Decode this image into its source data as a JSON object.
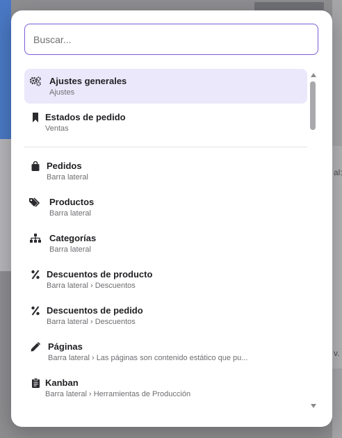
{
  "background": {
    "right_text_1": "al:",
    "right_text_2": "v."
  },
  "search": {
    "placeholder": "Buscar..."
  },
  "items": [
    {
      "title": "Ajustes generales",
      "subtitle": "Ajustes",
      "icon": "gears-icon",
      "active": true
    },
    {
      "title": "Estados de pedido",
      "subtitle": "Ventas",
      "icon": "bookmark-icon"
    },
    {
      "title": "Pedidos",
      "subtitle": "Barra lateral",
      "icon": "shopping-bag-icon"
    },
    {
      "title": "Productos",
      "subtitle": "Barra lateral",
      "icon": "tags-icon"
    },
    {
      "title": "Categorías",
      "subtitle": "Barra lateral",
      "icon": "sitemap-icon"
    },
    {
      "title": "Descuentos de producto",
      "subtitle": "Barra lateral › Descuentos",
      "icon": "percent-icon"
    },
    {
      "title": "Descuentos de pedido",
      "subtitle": "Barra lateral › Descuentos",
      "icon": "percent-icon"
    },
    {
      "title": "Páginas",
      "subtitle": "Barra lateral › Las páginas son contenido estático que pu...",
      "icon": "pencil-icon"
    },
    {
      "title": "Kanban",
      "subtitle": "Barra lateral › Herramientas de Producción",
      "icon": "clipboard-icon"
    }
  ],
  "colors": {
    "accent": "#7b5cd6",
    "active_bg": "#ece8fb"
  }
}
